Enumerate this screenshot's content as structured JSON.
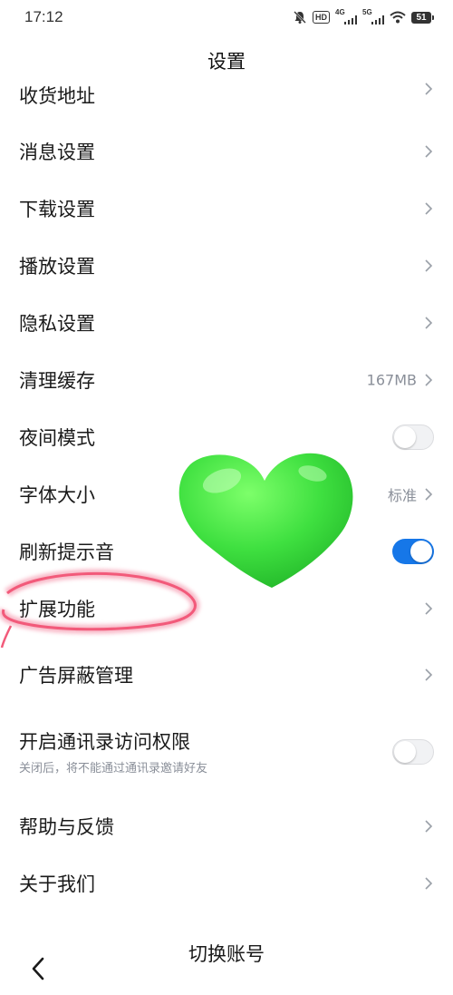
{
  "status_bar": {
    "time": "17:12",
    "hd_label": "HD",
    "net1_label": "4G",
    "net2_label": "5G",
    "battery": "51",
    "icons": [
      "mute-icon",
      "hd-icon",
      "signal-4g-icon",
      "signal-5g-icon",
      "wifi-icon",
      "battery-icon"
    ]
  },
  "header": {
    "title": "设置"
  },
  "rows": {
    "address": {
      "label": "收货地址"
    },
    "message": {
      "label": "消息设置"
    },
    "download": {
      "label": "下载设置"
    },
    "playback": {
      "label": "播放设置"
    },
    "privacy": {
      "label": "隐私设置"
    },
    "cache": {
      "label": "清理缓存",
      "value": "167MB"
    },
    "night_mode": {
      "label": "夜间模式",
      "on": false
    },
    "font_size": {
      "label": "字体大小",
      "value": "标准"
    },
    "refresh_sound": {
      "label": "刷新提示音",
      "on": true
    },
    "extensions": {
      "label": "扩展功能"
    },
    "ad_block": {
      "label": "广告屏蔽管理"
    },
    "contacts": {
      "label": "开启通讯录访问权限",
      "sublabel": "关闭后，将不能通过通讯录邀请好友",
      "on": false
    },
    "help": {
      "label": "帮助与反馈"
    },
    "about": {
      "label": "关于我们"
    }
  },
  "footer": {
    "switch_account": "切换账号"
  },
  "colors": {
    "accent": "#1677e8",
    "secondary_text": "#8a8f99",
    "heart": "#3fe040",
    "scribble": "#f25a7a"
  },
  "decorations": [
    "heart-sticker",
    "hand-drawn-circle"
  ]
}
